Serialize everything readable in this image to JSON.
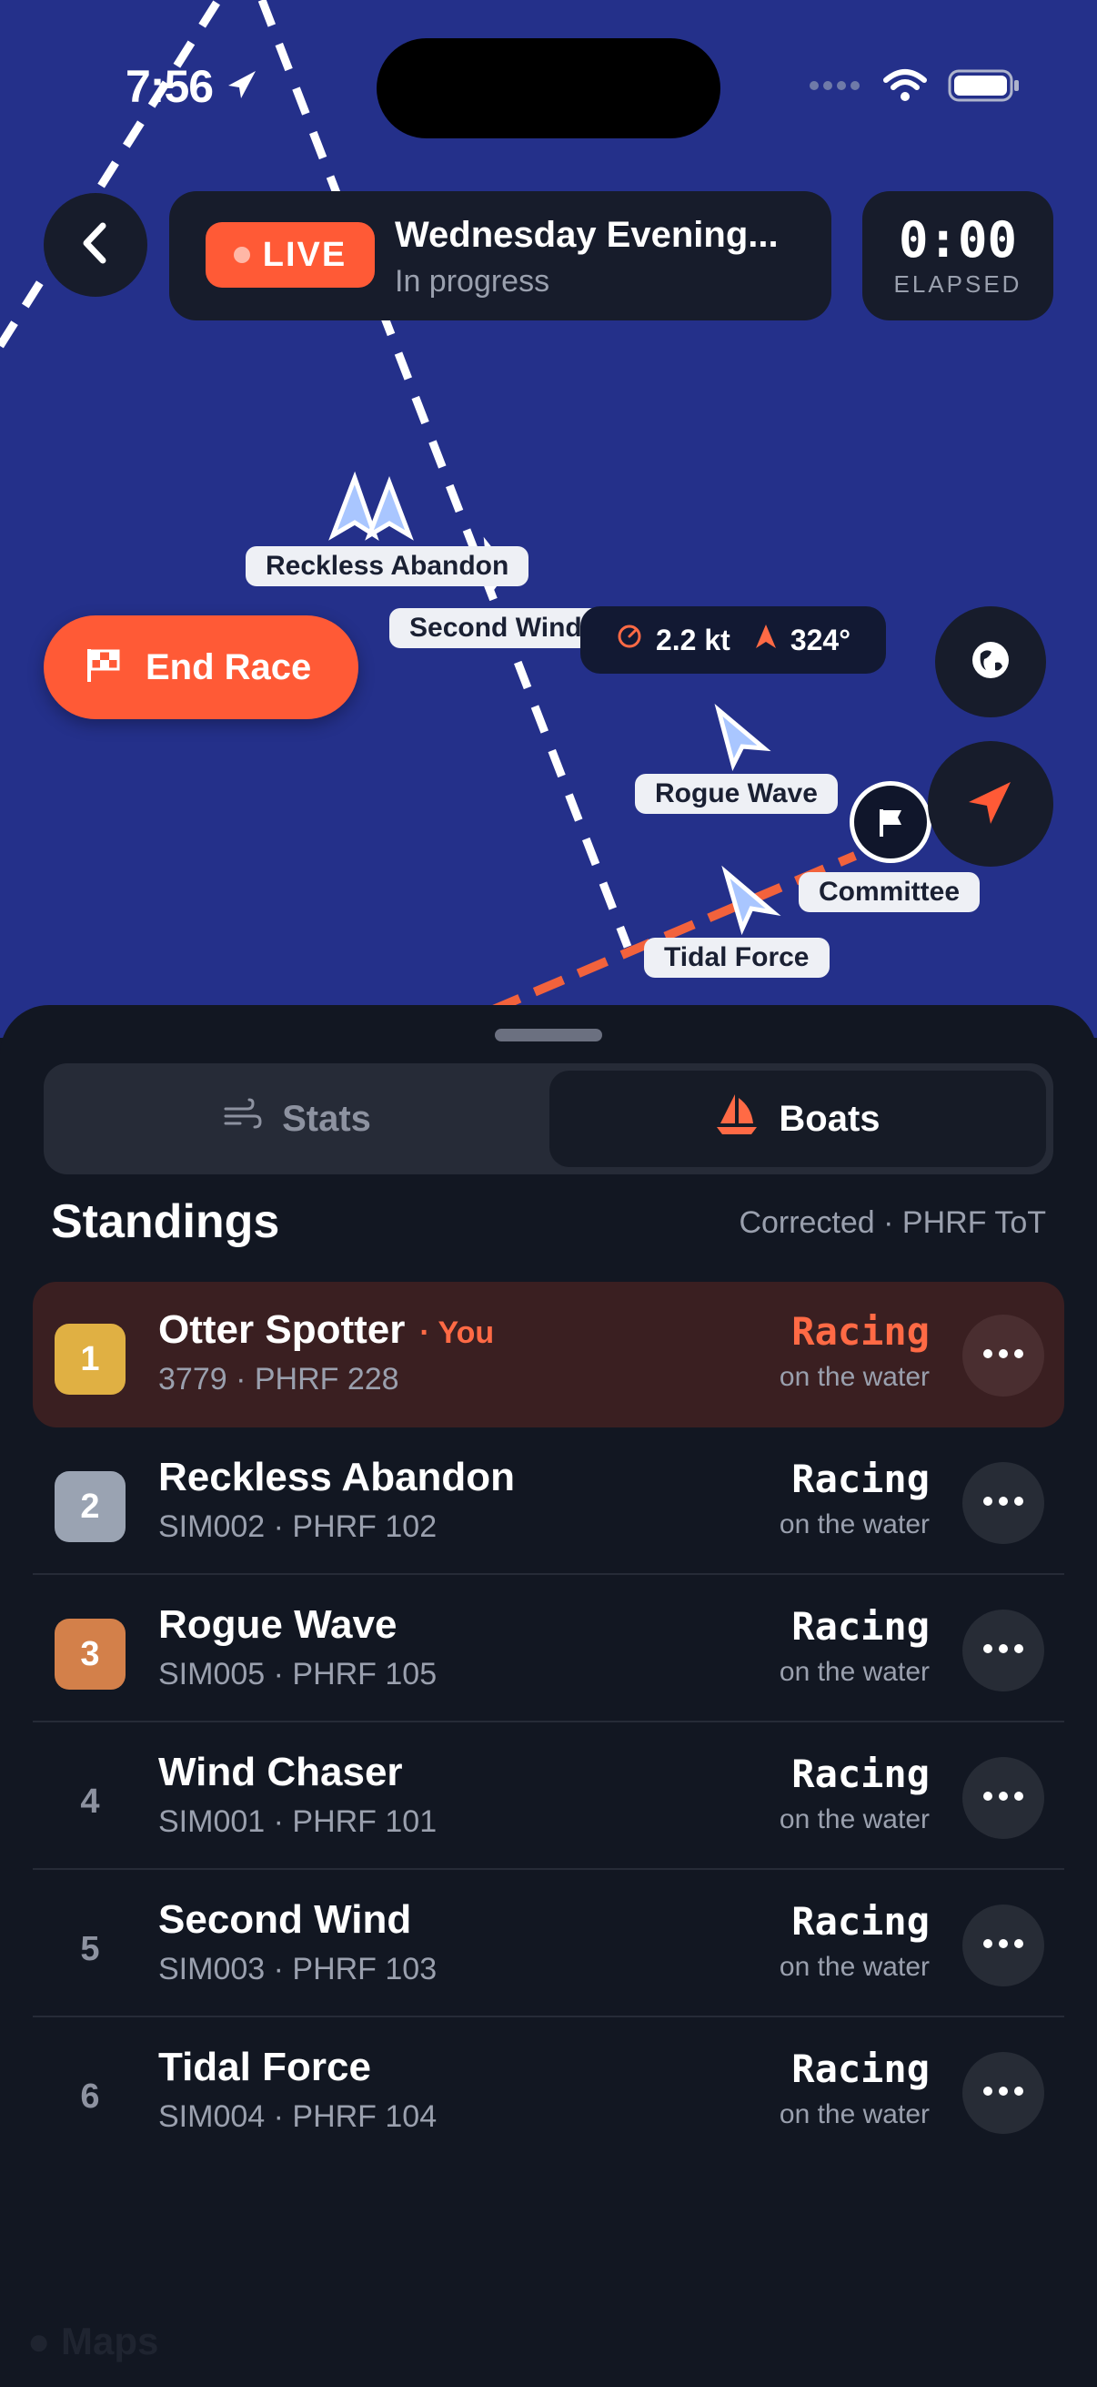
{
  "status_bar": {
    "time": "7:56"
  },
  "header": {
    "live_label": "LIVE",
    "race_title": "Wednesday Evening...",
    "race_status": "In progress",
    "elapsed_value": "0:00",
    "elapsed_label": "ELAPSED"
  },
  "map": {
    "end_race_label": "End Race",
    "speed": "2.2 kt",
    "heading": "324°",
    "boat_labels": [
      "Reckless Abandon",
      "Second Wind",
      "Rogue Wave",
      "Committee",
      "Tidal Force"
    ],
    "watermark": "Maps"
  },
  "sheet": {
    "tabs": [
      {
        "label": "Stats",
        "icon": "wind-icon",
        "selected": false
      },
      {
        "label": "Boats",
        "icon": "sailboat-icon",
        "selected": true
      }
    ],
    "standings_title": "Standings",
    "standings_subtitle": "Corrected · PHRF ToT",
    "you_tag": "· You",
    "rows": [
      {
        "rank": "1",
        "name": "Otter Spotter",
        "meta": "3779 · PHRF 228",
        "status": "Racing",
        "substatus": "on the water",
        "you": true
      },
      {
        "rank": "2",
        "name": "Reckless Abandon",
        "meta": "SIM002 · PHRF 102",
        "status": "Racing",
        "substatus": "on the water"
      },
      {
        "rank": "3",
        "name": "Rogue Wave",
        "meta": "SIM005 · PHRF 105",
        "status": "Racing",
        "substatus": "on the water"
      },
      {
        "rank": "4",
        "name": "Wind Chaser",
        "meta": "SIM001 · PHRF 101",
        "status": "Racing",
        "substatus": "on the water"
      },
      {
        "rank": "5",
        "name": "Second Wind",
        "meta": "SIM003 · PHRF 103",
        "status": "Racing",
        "substatus": "on the water"
      },
      {
        "rank": "6",
        "name": "Tidal Force",
        "meta": "SIM004 · PHRF 104",
        "status": "Racing",
        "substatus": "on the water"
      }
    ]
  },
  "colors": {
    "accent": "#ff5a36",
    "map_water": "#24308a",
    "rank_gold": "#e0b043",
    "rank_silver": "#9aa3b2",
    "rank_bronze": "#d3804a"
  }
}
